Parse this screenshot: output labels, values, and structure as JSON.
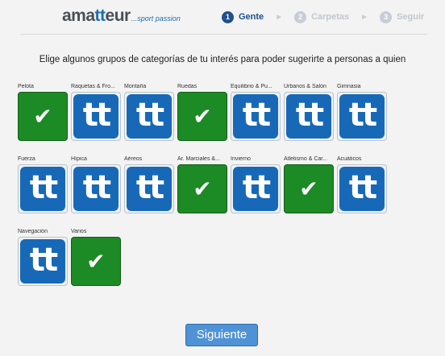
{
  "brand": {
    "name_a": "ama",
    "name_tt": "tt",
    "name_b": "eur",
    "tagline": "...sport passion"
  },
  "steps": [
    {
      "num": "1",
      "label": "Gente",
      "active": true
    },
    {
      "num": "2",
      "label": "Carpetas",
      "active": false
    },
    {
      "num": "3",
      "label": "Seguir",
      "active": false
    }
  ],
  "intro": "Elige algunos grupos de categorías de tu interés para poder sugerirte a personas a quien",
  "categories": [
    {
      "label": "Pelota",
      "selected": true,
      "icon": "tt-logo-icon"
    },
    {
      "label": "Raquetas & Fro...",
      "selected": false,
      "icon": "tt-logo-icon"
    },
    {
      "label": "Montaña",
      "selected": false,
      "icon": "tt-logo-icon"
    },
    {
      "label": "Ruedas",
      "selected": true,
      "icon": "tt-logo-icon"
    },
    {
      "label": "Equilibrio & Pu...",
      "selected": false,
      "icon": "tt-logo-icon"
    },
    {
      "label": "Urbanos & Salón",
      "selected": false,
      "icon": "tt-logo-icon"
    },
    {
      "label": "Gimnasia",
      "selected": false,
      "icon": "tt-logo-icon"
    },
    {
      "label": "Fuerza",
      "selected": false,
      "icon": "tt-logo-icon"
    },
    {
      "label": "Hípica",
      "selected": false,
      "icon": "tt-logo-icon"
    },
    {
      "label": "Aéreos",
      "selected": false,
      "icon": "tt-logo-icon"
    },
    {
      "label": "Ar. Marciales &...",
      "selected": true,
      "icon": "tt-logo-icon"
    },
    {
      "label": "Invierno",
      "selected": false,
      "icon": "tt-logo-icon"
    },
    {
      "label": "Atletismo & Car...",
      "selected": true,
      "icon": "tt-logo-icon"
    },
    {
      "label": "Acuáticos",
      "selected": false,
      "icon": "tt-logo-icon"
    },
    {
      "label": "Navegación",
      "selected": false,
      "icon": "tt-logo-icon"
    },
    {
      "label": "Varios",
      "selected": true,
      "icon": "tt-logo-icon"
    }
  ],
  "tile_text": "tt",
  "check_glyph": "✔",
  "next_button": "Siguiente",
  "colors": {
    "selected": "#1c8a25",
    "tile_blue": "#1769b8",
    "button": "#4f93d6",
    "active_step": "#1f4f8c"
  }
}
